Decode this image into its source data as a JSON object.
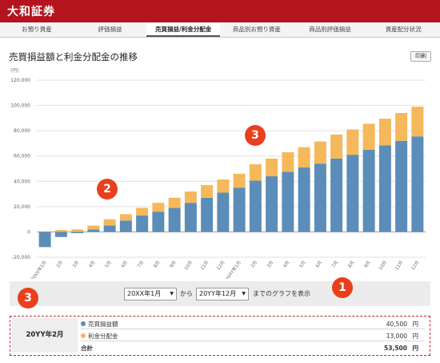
{
  "header": {
    "brand": "大和証券"
  },
  "tabs": [
    {
      "label": "お預り資産",
      "active": false
    },
    {
      "label": "評価損益",
      "active": false
    },
    {
      "label": "売買損益/利金分配金",
      "active": true
    },
    {
      "label": "商品別お預り資産",
      "active": false
    },
    {
      "label": "商品別評価損益",
      "active": false
    },
    {
      "label": "資産配分状況",
      "active": false
    }
  ],
  "page": {
    "title": "売買損益額と利金分配金の推移",
    "print_label": "印刷",
    "unit_label": "(円)"
  },
  "colors": {
    "series_profit": "#5b8db8",
    "series_dividend": "#f5b85a",
    "accent": "#e8401c",
    "brand": "#b3141e"
  },
  "chart_data": {
    "type": "bar",
    "stacked": true,
    "ylim": [
      -20000,
      120000
    ],
    "yticks": [
      -20000,
      0,
      20000,
      40000,
      60000,
      80000,
      100000,
      120000
    ],
    "ytick_labels": [
      "-20,000",
      "0",
      "20,000",
      "40,000",
      "60,000",
      "80,000",
      "100,000",
      "120,000"
    ],
    "grid": true,
    "categories": [
      "20XX年1月",
      "2月",
      "3月",
      "4月",
      "5月",
      "6月",
      "7月",
      "8月",
      "9月",
      "10月",
      "11月",
      "12月",
      "20YY年1月",
      "2月",
      "3月",
      "4月",
      "5月",
      "6月",
      "7月",
      "8月",
      "9月",
      "10月",
      "11月",
      "12月"
    ],
    "series": [
      {
        "name": "売買損益額",
        "values": [
          -12000,
          -4000,
          -1000,
          2000,
          5000,
          9000,
          13000,
          16000,
          19000,
          23000,
          27000,
          31000,
          35000,
          40500,
          44000,
          47500,
          51000,
          54000,
          58000,
          61000,
          65000,
          68500,
          72000,
          75500
        ]
      },
      {
        "name": "利金分配金",
        "values": [
          0,
          1500,
          2000,
          3000,
          5000,
          5000,
          6000,
          7000,
          8000,
          9000,
          10000,
          10500,
          11000,
          13000,
          14000,
          15500,
          16000,
          17500,
          19000,
          20000,
          20500,
          21000,
          22000,
          23500
        ]
      }
    ]
  },
  "range": {
    "from": "20XX年1月",
    "connector": "から",
    "to": "20YY年12月",
    "action": "までのグラフを表示"
  },
  "detail": {
    "month": "20YY年2月",
    "rows": [
      {
        "label": "売買損益額",
        "value": "40,500",
        "unit": "円"
      },
      {
        "label": "利金分配金",
        "value": "13,000",
        "unit": "円"
      }
    ],
    "total": {
      "label": "合計",
      "value": "53,500",
      "unit": "円"
    }
  },
  "badges": [
    "1",
    "2",
    "3",
    "3"
  ]
}
